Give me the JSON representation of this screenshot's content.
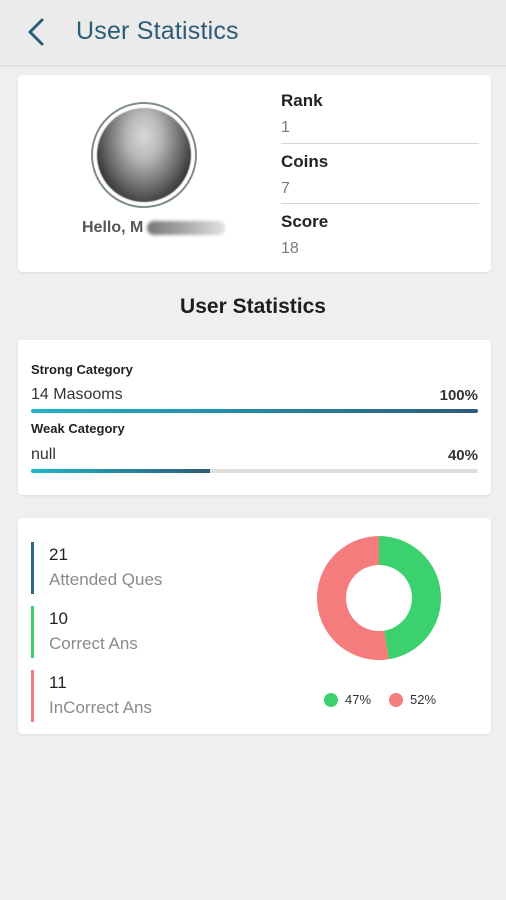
{
  "appbar": {
    "title": "User Statistics",
    "back_icon": "chevron-left-icon"
  },
  "profile": {
    "greeting": "Hello, M",
    "stats": [
      {
        "label": "Rank",
        "value": "1"
      },
      {
        "label": "Coins",
        "value": "7"
      },
      {
        "label": "Score",
        "value": "18"
      }
    ]
  },
  "section_title": "User Statistics",
  "categories": {
    "strong": {
      "label": "Strong Category",
      "name": "14 Masooms",
      "percent_text": "100%",
      "percent": 100
    },
    "weak": {
      "label": "Weak Category",
      "name": "null",
      "percent_text": "40%",
      "percent": 40
    }
  },
  "answers": [
    {
      "count": "21",
      "label": "Attended Ques",
      "color": "#2c6a86"
    },
    {
      "count": "10",
      "label": "Correct Ans",
      "color": "#3bd16f"
    },
    {
      "count": "11",
      "label": "InCorrect Ans",
      "color": "#f47c7c"
    }
  ],
  "chart_data": {
    "type": "pie",
    "donut": true,
    "categories": [
      "Correct",
      "Incorrect"
    ],
    "values": [
      47,
      52
    ],
    "colors": [
      "#3bd16f",
      "#f47c7c"
    ],
    "legend": [
      "47%",
      "52%"
    ],
    "legend_position": "bottom"
  },
  "colors": {
    "accent": "#2c5c77",
    "progress_start": "#1fb5c9",
    "correct": "#3bd16f",
    "incorrect": "#f47c7c"
  }
}
